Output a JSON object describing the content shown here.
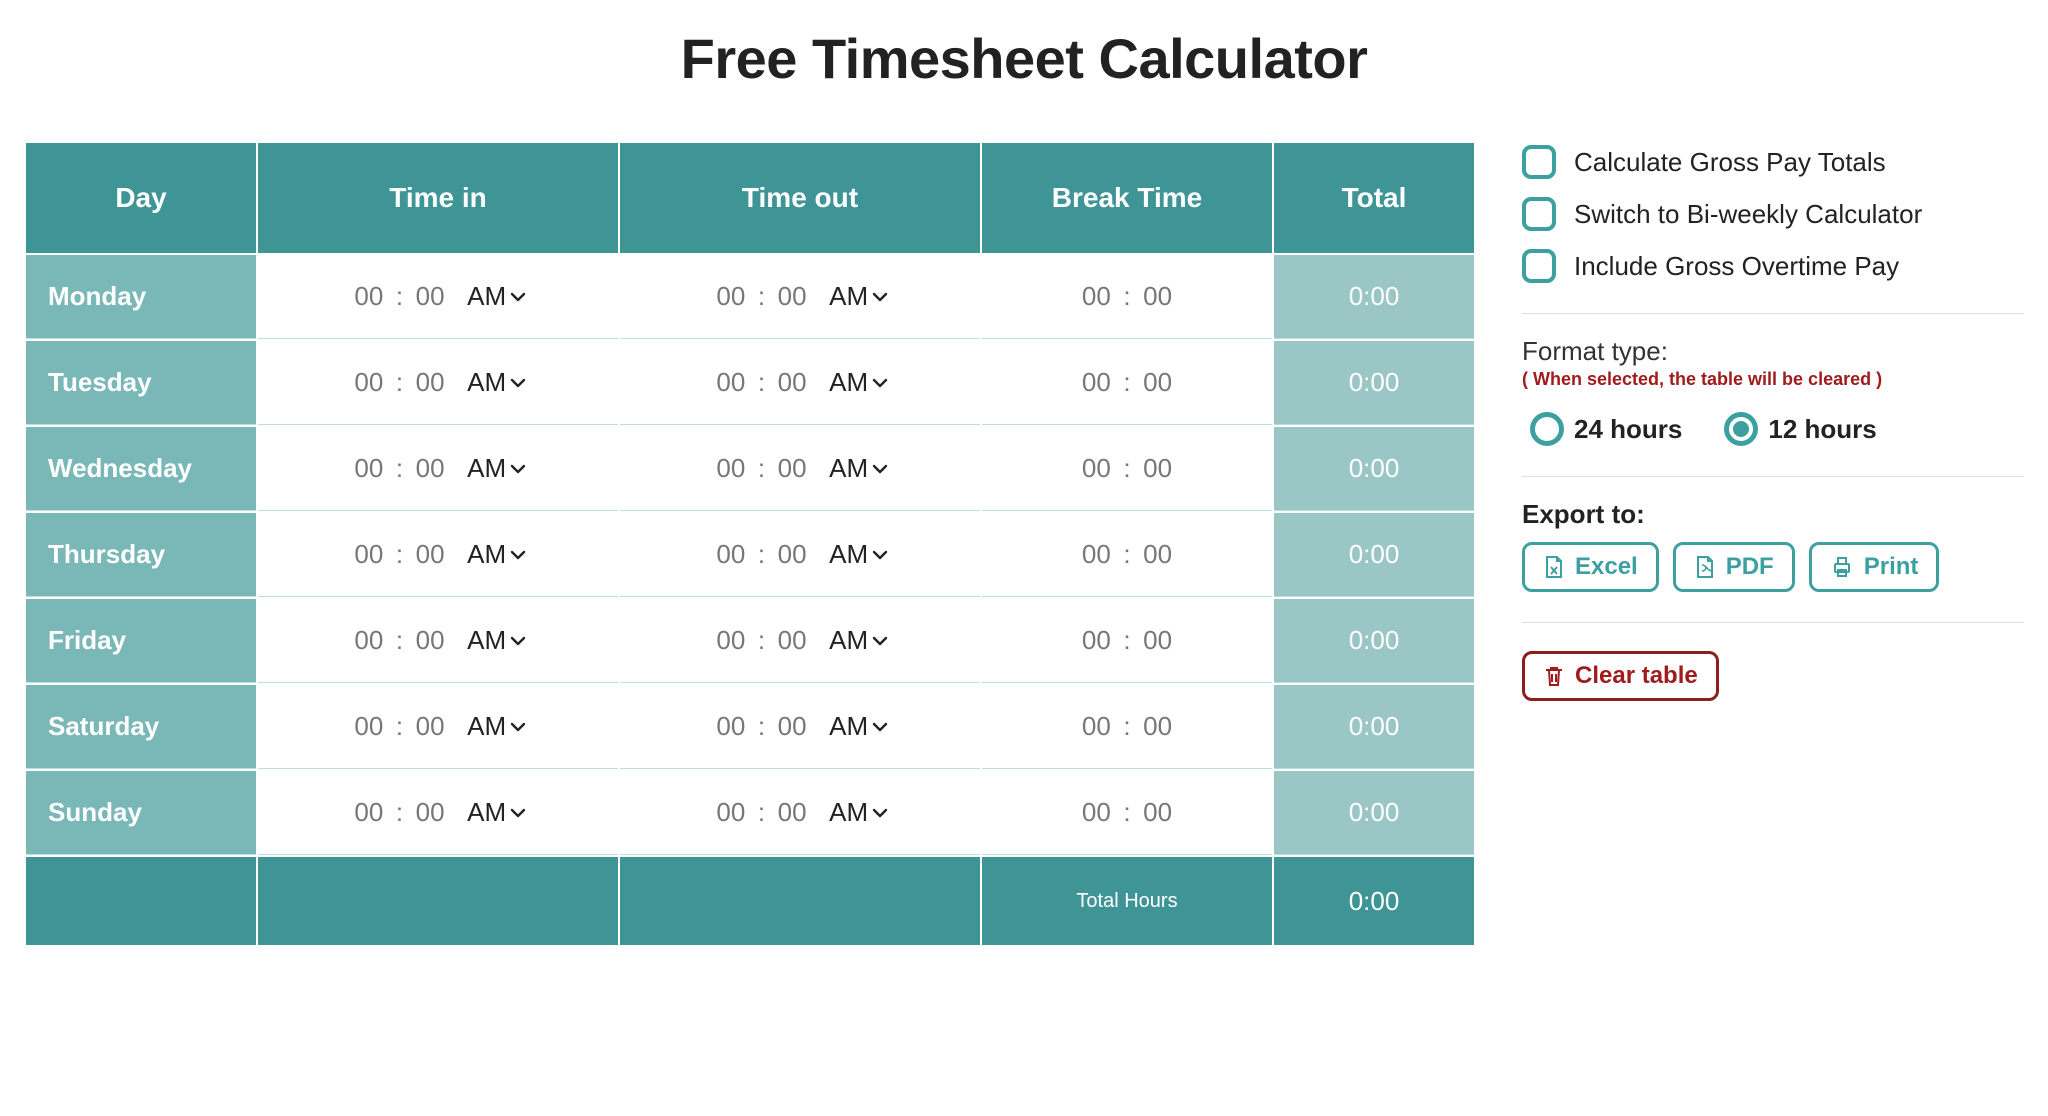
{
  "title": "Free Timesheet Calculator",
  "table": {
    "headers": {
      "day": "Day",
      "time_in": "Time in",
      "time_out": "Time out",
      "break": "Break Time",
      "total": "Total"
    },
    "rows": [
      {
        "day": "Monday",
        "in_h": "00",
        "in_m": "00",
        "in_ampm": "AM",
        "out_h": "00",
        "out_m": "00",
        "out_ampm": "AM",
        "br_h": "00",
        "br_m": "00",
        "total": "0:00"
      },
      {
        "day": "Tuesday",
        "in_h": "00",
        "in_m": "00",
        "in_ampm": "AM",
        "out_h": "00",
        "out_m": "00",
        "out_ampm": "AM",
        "br_h": "00",
        "br_m": "00",
        "total": "0:00"
      },
      {
        "day": "Wednesday",
        "in_h": "00",
        "in_m": "00",
        "in_ampm": "AM",
        "out_h": "00",
        "out_m": "00",
        "out_ampm": "AM",
        "br_h": "00",
        "br_m": "00",
        "total": "0:00"
      },
      {
        "day": "Thursday",
        "in_h": "00",
        "in_m": "00",
        "in_ampm": "AM",
        "out_h": "00",
        "out_m": "00",
        "out_ampm": "AM",
        "br_h": "00",
        "br_m": "00",
        "total": "0:00"
      },
      {
        "day": "Friday",
        "in_h": "00",
        "in_m": "00",
        "in_ampm": "AM",
        "out_h": "00",
        "out_m": "00",
        "out_ampm": "AM",
        "br_h": "00",
        "br_m": "00",
        "total": "0:00"
      },
      {
        "day": "Saturday",
        "in_h": "00",
        "in_m": "00",
        "in_ampm": "AM",
        "out_h": "00",
        "out_m": "00",
        "out_ampm": "AM",
        "br_h": "00",
        "br_m": "00",
        "total": "0:00"
      },
      {
        "day": "Sunday",
        "in_h": "00",
        "in_m": "00",
        "in_ampm": "AM",
        "out_h": "00",
        "out_m": "00",
        "out_ampm": "AM",
        "br_h": "00",
        "br_m": "00",
        "total": "0:00"
      }
    ],
    "footer_label": "Total Hours",
    "footer_total": "0:00"
  },
  "options": {
    "gross_pay": "Calculate Gross Pay Totals",
    "biweekly": "Switch to Bi-weekly Calculator",
    "overtime": "Include Gross Overtime Pay"
  },
  "format": {
    "label": "Format type:",
    "warning": "( When selected, the table will be cleared )",
    "opt24": "24 hours",
    "opt12": "12 hours",
    "selected": "12"
  },
  "export": {
    "label": "Export to:",
    "excel": "Excel",
    "pdf": "PDF",
    "print": "Print"
  },
  "clear_label": "Clear table"
}
